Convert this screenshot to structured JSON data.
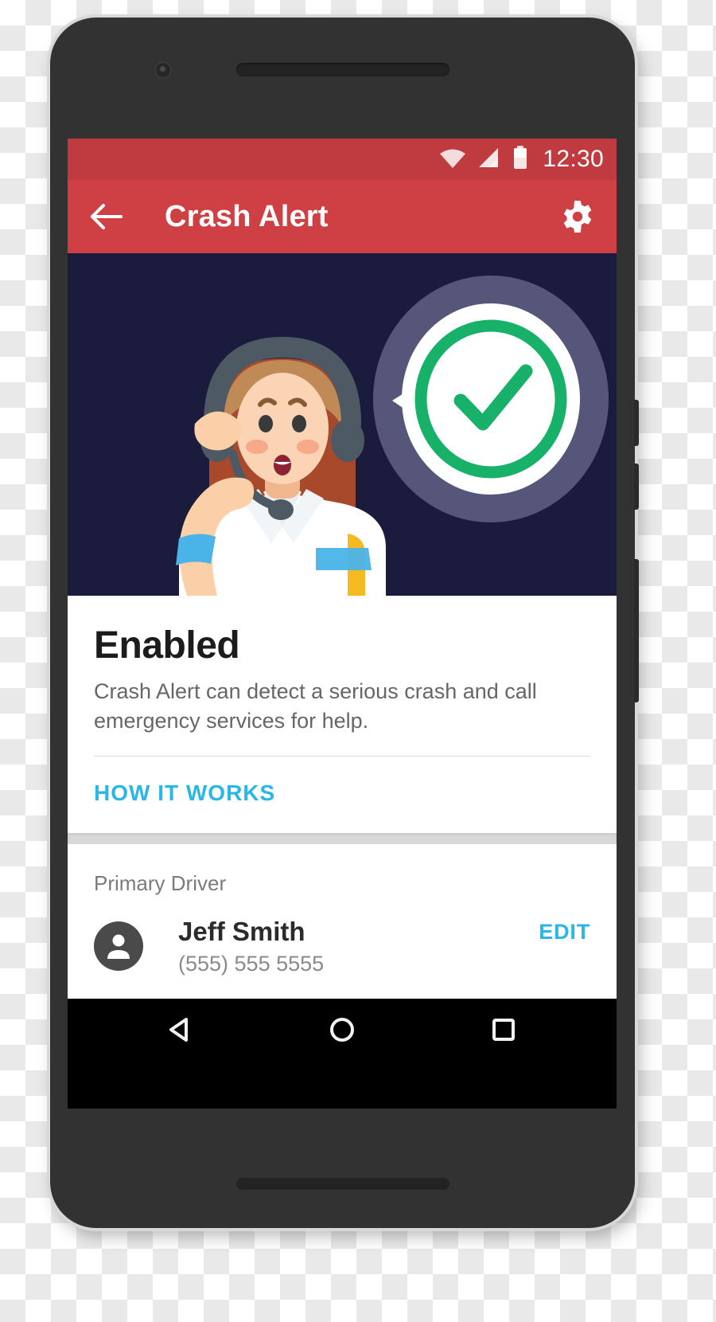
{
  "device": {
    "name": "android-phone-mockup",
    "body_color": "#323232",
    "screen_bg": "#000000"
  },
  "status_bar": {
    "time": "12:30",
    "background": "#bf3b3f",
    "icons": [
      "wifi-icon",
      "cellular-signal-icon",
      "battery-icon"
    ]
  },
  "app_bar": {
    "title": "Crash Alert",
    "background": "#cf4044",
    "back_icon": "arrow-left-icon",
    "settings_icon": "gear-icon"
  },
  "hero": {
    "name": "crash-alert-illustration",
    "background": "#1b1b3e",
    "description": "Call center operator wearing a headset with a speech bubble containing a green check mark",
    "accent_green": "#17b169",
    "halo_color": "#56557a"
  },
  "status_card": {
    "title": "Enabled",
    "description": "Crash Alert can detect a serious crash and call emergency services for help.",
    "link_label": "HOW IT WORKS",
    "link_color": "#29b6e8"
  },
  "driver_card": {
    "section_label": "Primary Driver",
    "avatar_icon": "person-icon",
    "name": "Jeff Smith",
    "phone": "(555) 555 5555",
    "edit_label": "EDIT",
    "edit_color": "#29b6e8"
  },
  "nav_bar": {
    "background": "#000000",
    "buttons": [
      "back-triangle-icon",
      "home-circle-icon",
      "recents-square-icon"
    ]
  }
}
